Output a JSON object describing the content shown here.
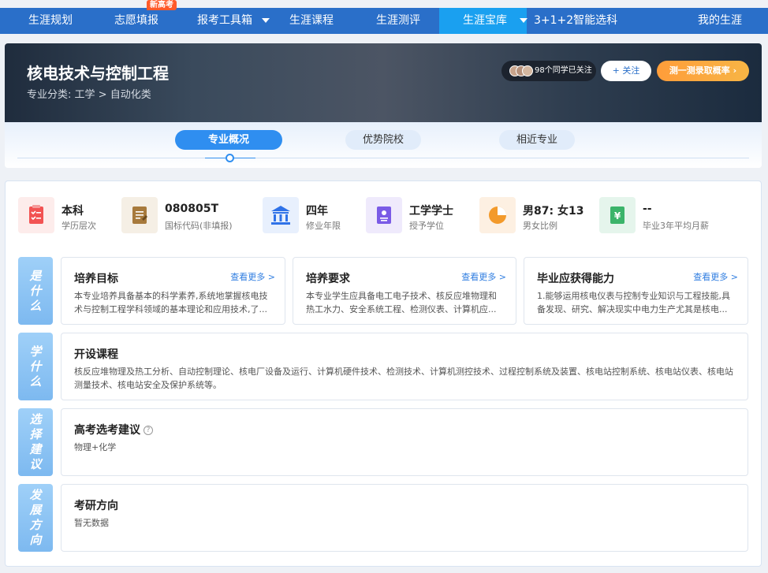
{
  "nav": {
    "items": [
      {
        "label": "生涯规划"
      },
      {
        "label": "志愿填报"
      },
      {
        "label": "报考工具箱"
      },
      {
        "label": "生涯课程"
      },
      {
        "label": "生涯测评"
      },
      {
        "label": "生涯宝库"
      },
      {
        "label": "3+1+2智能选科"
      },
      {
        "label": "我的生涯"
      }
    ],
    "badge": "新高考"
  },
  "header": {
    "title": "核电技术与控制工程",
    "category_label": "专业分类:",
    "category_path": "工学 > 自动化类",
    "followers": "98个同学已关注",
    "follow_button": "+ 关注",
    "test_button": "测一测录取概率 ›"
  },
  "tabs": [
    {
      "label": "专业概况"
    },
    {
      "label": "优势院校"
    },
    {
      "label": "相近专业"
    }
  ],
  "stats": [
    {
      "value": "本科",
      "label": "学历层次",
      "icon": "clipboard-icon",
      "color": "#f25353"
    },
    {
      "value": "080805T",
      "label": "国标代码(非填报)",
      "icon": "document-icon",
      "color": "#a77a3c"
    },
    {
      "value": "四年",
      "label": "修业年限",
      "icon": "building-icon",
      "color": "#2f72e8"
    },
    {
      "value": "工学学士",
      "label": "授予学位",
      "icon": "badge-icon",
      "color": "#7a5be6"
    },
    {
      "value": "男87: 女13",
      "label": "男女比例",
      "icon": "pie-icon",
      "color": "#f39a2b"
    },
    {
      "value": "--",
      "label": "毕业3年平均月薪",
      "icon": "money-icon",
      "color": "#3bb46a"
    }
  ],
  "sections": {
    "what": {
      "side": [
        "是",
        "什",
        "么"
      ],
      "cards": [
        {
          "title": "培养目标",
          "more": "查看更多 >",
          "text": "本专业培养具备基本的科学素养,系统地掌握核电技术与控制工程学科领域的基本理论和应用技术,了..."
        },
        {
          "title": "培养要求",
          "more": "查看更多 >",
          "text": "本专业学生应具备电工电子技术、核反应堆物理和热工水力、安全系统工程、检测仪表、计算机应..."
        },
        {
          "title": "毕业应获得能力",
          "more": "查看更多 >",
          "text": "1.能够运用核电仪表与控制专业知识与工程技能,具备发现、研究、解决现实中电力生产尤其是核电..."
        }
      ]
    },
    "learn": {
      "side": [
        "学",
        "什",
        "么"
      ],
      "title": "开设课程",
      "text": "核反应堆物理及热工分析、自动控制理论、核电厂设备及运行、计算机硬件技术、检测技术、计算机测控技术、过程控制系统及装置、核电站控制系统、核电站仪表、核电站测量技术、核电站安全及保护系统等。"
    },
    "choose": {
      "side": [
        "选",
        "择",
        "建",
        "议"
      ],
      "title": "高考选考建议",
      "help": "?",
      "text": "物理+化学"
    },
    "develop": {
      "side": [
        "发",
        "展",
        "方",
        "向"
      ],
      "title": "考研方向",
      "text": "暂无数据"
    }
  }
}
